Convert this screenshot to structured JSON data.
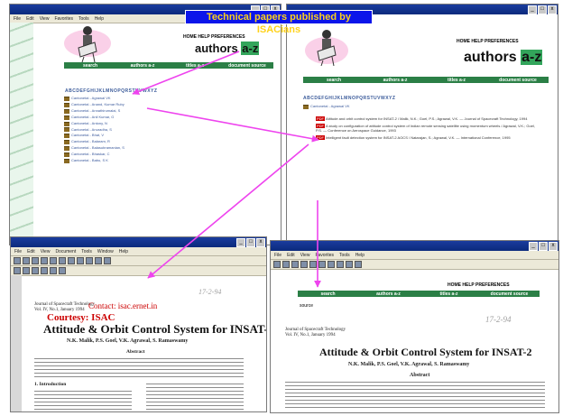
{
  "banner": {
    "title": "Technical  papers published by ISACians"
  },
  "win_left": {
    "menu": [
      "File",
      "Edit",
      "View",
      "Favorites",
      "Tools",
      "Help"
    ],
    "header_links": "HOME HELP PREFERENCES",
    "authors_word": "authors",
    "authors_range": "a-z",
    "nav": [
      "search",
      "authors a-z",
      "titles a-z",
      "document source"
    ],
    "alphabet": "ABCDEFGHIJKLMNOPQRSTUVWXYZ",
    "list": [
      "Cantonetal - Agrawal VK",
      "Cantonetal - Anand, Kumar Ruby",
      "Cantonetal - Annathirumalai, S",
      "Cantonetal - Anil Kumar, G",
      "Cantonetal - Antony, N",
      "Cantonetal - Anuradha, S",
      "Cantonetal - Bhat, V",
      "Cantonetal - Balaram, R",
      "Cantonetal - Balasubramanian, S",
      "Cantonetal - Bhaskar, C",
      "Cantonetal - Babu, S K"
    ]
  },
  "win_right": {
    "header_links": "HOME HELP PREFERENCES",
    "authors_word": "authors",
    "authors_range": "a-z",
    "nav": [
      "search",
      "authors a-z",
      "titles a-z",
      "document source"
    ],
    "alphabet": "ABCDEFGHIJKLMNOPQRSTUVWXYZ",
    "folder_label": "Cantonetal - Agrawal VK",
    "records": [
      {
        "pdf": "PDF",
        "text": "Attitude and orbit control system for INSAT-2 / Malik, N.K.; Goel, P.S.; Agrawal, V.K. — Journal of Spacecraft Technology, 1994"
      },
      {
        "pdf": "PDF",
        "text": "A study on configuration of attitude control system of Indian remote sensing satellite using momentum wheels / Agrawal, V.K.; Goel, P.S. — Conference on Aerospace Guidance, 1993"
      },
      {
        "pdf": "PDF",
        "text": "Intelligent fault detection system for INSAT-2 AOCS / Natarajan, S.; Agrawal, V.K. — International Conference, 1995"
      }
    ]
  },
  "win_bottom_left": {
    "menu": [
      "File",
      "Edit",
      "View",
      "Document",
      "Tools",
      "Window",
      "Help"
    ],
    "journal": "Journal of Spacecraft Technology",
    "journal_info": "Vol. IV, No.1, January 1994",
    "page_num": "17-2-94",
    "ghost_email": "Contact: isac.ernet.in",
    "ghost_copy": "Courtesy: ISAC",
    "title": "Attitude & Orbit Control System for INSAT-2",
    "authors": "N.K. Malik, P.S. Goel, V.K. Agrawal, S. Ramaswamy",
    "abstract": "Abstract",
    "intro": "1.  Introduction"
  },
  "win_bottom_right": {
    "menu": [
      "File",
      "Edit",
      "View",
      "Favorites",
      "Tools",
      "Help"
    ],
    "header_links": "HOME HELP PREFERENCES",
    "nav": [
      "search",
      "authors a-z",
      "titles a-z",
      "document source"
    ],
    "small_label": "source",
    "page_num": "17-2-94",
    "journal": "Journal of Spacecraft Technology",
    "journal_info": "Vol. IV, No.1, January 1994",
    "title": "Attitude & Orbit Control System for INSAT-2",
    "authors": "N.K. Malik, P.S. Goel, V.K. Agrawal, S. Ramaswamy",
    "abstract": "Abstract"
  },
  "colors": {
    "banner_bg": "#0b15ea",
    "banner_text": "#ffd21a",
    "arrow": "#ee44ee",
    "nav_green": "#2b7f46",
    "titlebar": "#0b2a7c"
  }
}
